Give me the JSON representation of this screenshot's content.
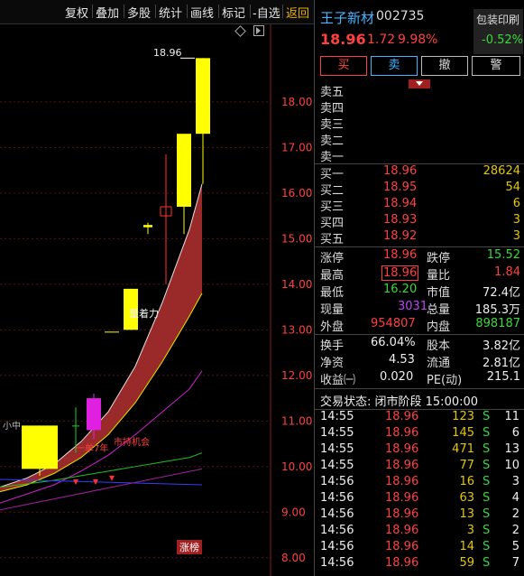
{
  "toolbar": {
    "items": [
      "复权",
      "叠加",
      "多股",
      "统计",
      "画线",
      "标记",
      "-自选"
    ],
    "back": "返回"
  },
  "chart": {
    "price_labels": [
      "18.00",
      "17.00",
      "16.00",
      "15.00",
      "14.00",
      "13.00",
      "12.00",
      "11.00",
      "10.00",
      "9.00",
      "8.00"
    ],
    "high_label": "18.96",
    "annotation_pressure": "量着力",
    "annotation_left": "小中",
    "annotation_mid1": "一单7年",
    "annotation_mid2": "市持机会",
    "limit_badge": "涨榜"
  },
  "chart_data": {
    "type": "candlestick",
    "ylim": [
      7.6,
      19.7
    ],
    "candles": [
      {
        "o": 9.95,
        "c": 10.9,
        "h": 10.9,
        "l": 9.8,
        "color": "yellow"
      },
      {
        "o": 10.9,
        "c": 10.9,
        "h": 11.3,
        "l": 10.3,
        "color": "green"
      },
      {
        "o": 10.8,
        "c": 11.5,
        "h": 11.6,
        "l": 10.6,
        "color": "magenta"
      },
      {
        "o": 13.0,
        "c": 13.9,
        "h": 13.9,
        "l": 13.0,
        "color": "yellow"
      },
      {
        "o": 15.25,
        "c": 15.3,
        "h": 15.35,
        "l": 15.1,
        "color": "yellow"
      },
      {
        "o": 15.5,
        "c": 15.7,
        "h": 16.85,
        "l": 14.0,
        "color": "red"
      },
      {
        "o": 15.7,
        "c": 17.3,
        "h": 17.3,
        "l": 15.1,
        "color": "yellow"
      },
      {
        "o": 17.3,
        "c": 18.96,
        "h": 18.96,
        "l": 16.2,
        "color": "yellow"
      }
    ]
  },
  "stock": {
    "name": "王子新材",
    "code": "002735",
    "price": "18.96",
    "change": "1.72",
    "pct": "9.98%"
  },
  "sector": {
    "name": "包装印刷",
    "pct": "-0.52%"
  },
  "buttons": {
    "buy": "买",
    "sell": "卖",
    "cancel": "撤",
    "alert": "警"
  },
  "asks": [
    {
      "label": "卖五"
    },
    {
      "label": "卖四"
    },
    {
      "label": "卖三"
    },
    {
      "label": "卖二"
    },
    {
      "label": "卖一"
    }
  ],
  "bids": [
    {
      "label": "买一",
      "price": "18.96",
      "vol": "28624"
    },
    {
      "label": "买二",
      "price": "18.95",
      "vol": "54"
    },
    {
      "label": "买三",
      "price": "18.94",
      "vol": "6"
    },
    {
      "label": "买四",
      "price": "18.93",
      "vol": "3"
    },
    {
      "label": "买五",
      "price": "18.92",
      "vol": "3"
    }
  ],
  "stats": {
    "limit_up_label": "涨停",
    "limit_up": "18.96",
    "limit_down_label": "跌停",
    "limit_down": "15.52",
    "high_label": "最高",
    "high": "18.96",
    "vol_ratio_label": "量比",
    "vol_ratio": "1.84",
    "low_label": "最低",
    "low": "16.20",
    "mktcap_label": "市值",
    "mktcap": "72.4亿",
    "now_vol_label": "现量",
    "now_vol": "3031",
    "total_vol_label": "总量",
    "total_vol": "185.3万",
    "out_label": "外盘",
    "out": "954807",
    "in_label": "内盘",
    "in": "898187",
    "turnover_label": "换手",
    "turnover": "66.04%",
    "equity_label": "股本",
    "equity": "3.82亿",
    "nav_label": "净资",
    "nav": "4.53",
    "float_label": "流通",
    "float": "2.81亿",
    "eps_label": "收益㈠",
    "eps": "0.020",
    "pe_label": "PE(动)",
    "pe": "215.1"
  },
  "status": "交易状态: 闭市阶段 15:00:00",
  "ticks": [
    {
      "t": "14:55",
      "p": "18.96",
      "v": "123",
      "s": "S",
      "n": "11"
    },
    {
      "t": "14:55",
      "p": "18.96",
      "v": "145",
      "s": "S",
      "n": "6"
    },
    {
      "t": "14:55",
      "p": "18.96",
      "v": "471",
      "s": "S",
      "n": "13"
    },
    {
      "t": "14:55",
      "p": "18.96",
      "v": "77",
      "s": "S",
      "n": "10"
    },
    {
      "t": "14:56",
      "p": "18.96",
      "v": "16",
      "s": "S",
      "n": "3"
    },
    {
      "t": "14:56",
      "p": "18.96",
      "v": "63",
      "s": "S",
      "n": "4"
    },
    {
      "t": "14:56",
      "p": "18.96",
      "v": "13",
      "s": "S",
      "n": "2"
    },
    {
      "t": "14:56",
      "p": "18.96",
      "v": "3",
      "s": "S",
      "n": "2"
    },
    {
      "t": "14:56",
      "p": "18.96",
      "v": "14",
      "s": "S",
      "n": "5"
    },
    {
      "t": "14:56",
      "p": "18.96",
      "v": "59",
      "s": "S",
      "n": "7"
    }
  ],
  "colors": {
    "up": "#ff4040",
    "down": "#3ad83a",
    "accent": "#43b4ff",
    "volume": "#e6c700"
  }
}
